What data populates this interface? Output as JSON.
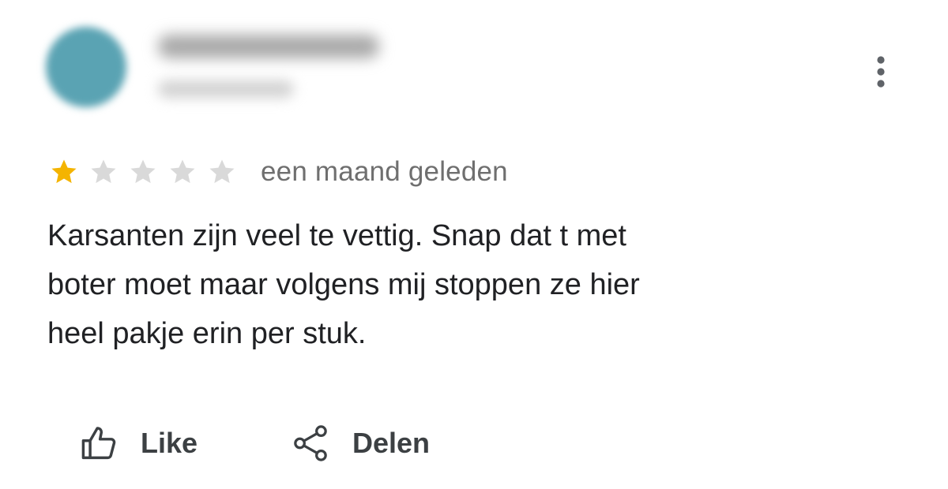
{
  "reviewer": {
    "avatar_color": "#5aa3b3",
    "name_blurred": true,
    "meta_blurred": true
  },
  "menu": {
    "icon": "more-vert-icon"
  },
  "review": {
    "rating": 1,
    "max_rating": 5,
    "filled_star_color": "#f4b400",
    "empty_star_color": "#d9d9d9",
    "date": "een maand geleden",
    "text": "Karsanten zijn veel te vettig. Snap dat t met\nboter moet maar volgens mij stoppen ze hier\nheel pakje erin per stuk."
  },
  "actions": {
    "like": {
      "label": "Like",
      "icon": "thumbs-up-icon"
    },
    "share": {
      "label": "Delen",
      "icon": "share-icon"
    }
  }
}
